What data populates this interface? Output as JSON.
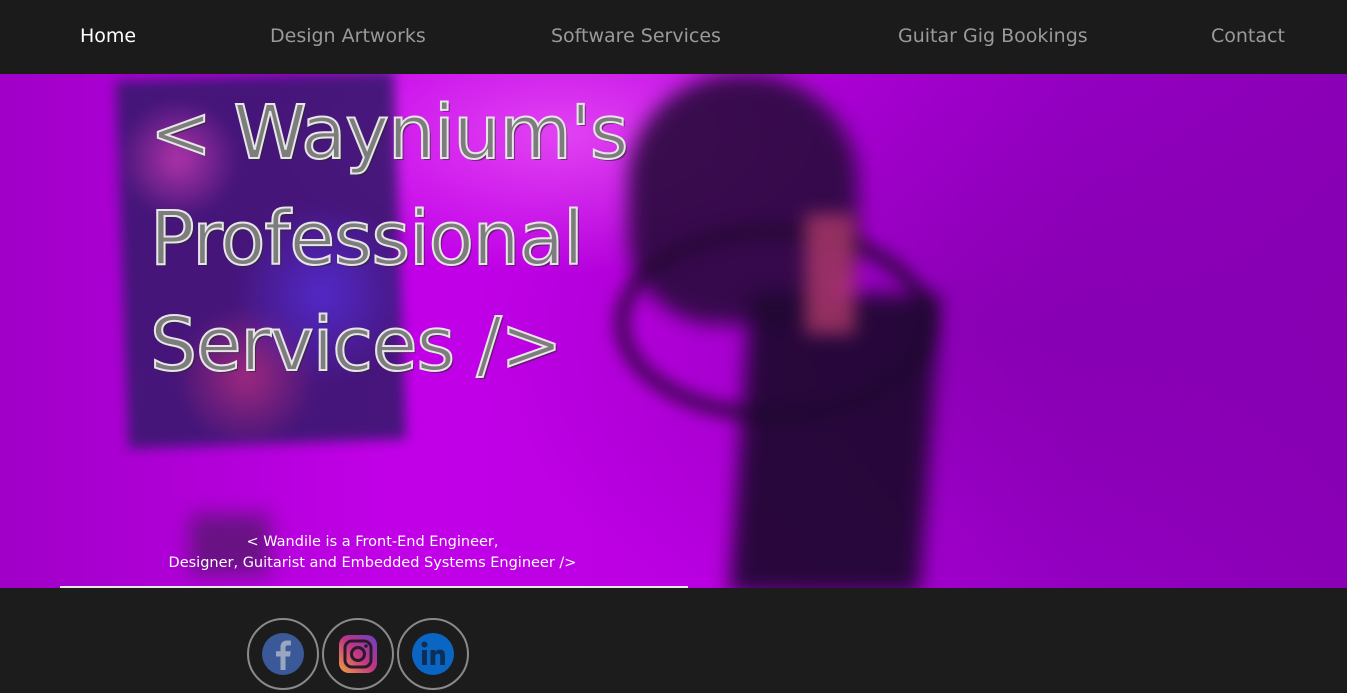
{
  "nav": {
    "items": [
      {
        "label": "Home",
        "active": true
      },
      {
        "label": "Design Artworks",
        "active": false
      },
      {
        "label": "Software Services",
        "active": false
      },
      {
        "label": "Guitar Gig Bookings",
        "active": false
      },
      {
        "label": "Contact",
        "active": false
      }
    ]
  },
  "hero": {
    "title_line1": "< Waynium's",
    "title_line2": "Professional",
    "title_line3": "Services />",
    "subtitle_line1": "< Wandile is a Front-End Engineer,",
    "subtitle_line2": "Designer, Guitarist and Embedded Systems Engineer />",
    "accent_color": "#b300d6"
  },
  "social": [
    {
      "icon": "facebook-icon",
      "color": "#3b5998"
    },
    {
      "icon": "instagram-icon",
      "color": "#c13584"
    },
    {
      "icon": "linkedin-icon",
      "color": "#0a66c2"
    }
  ]
}
